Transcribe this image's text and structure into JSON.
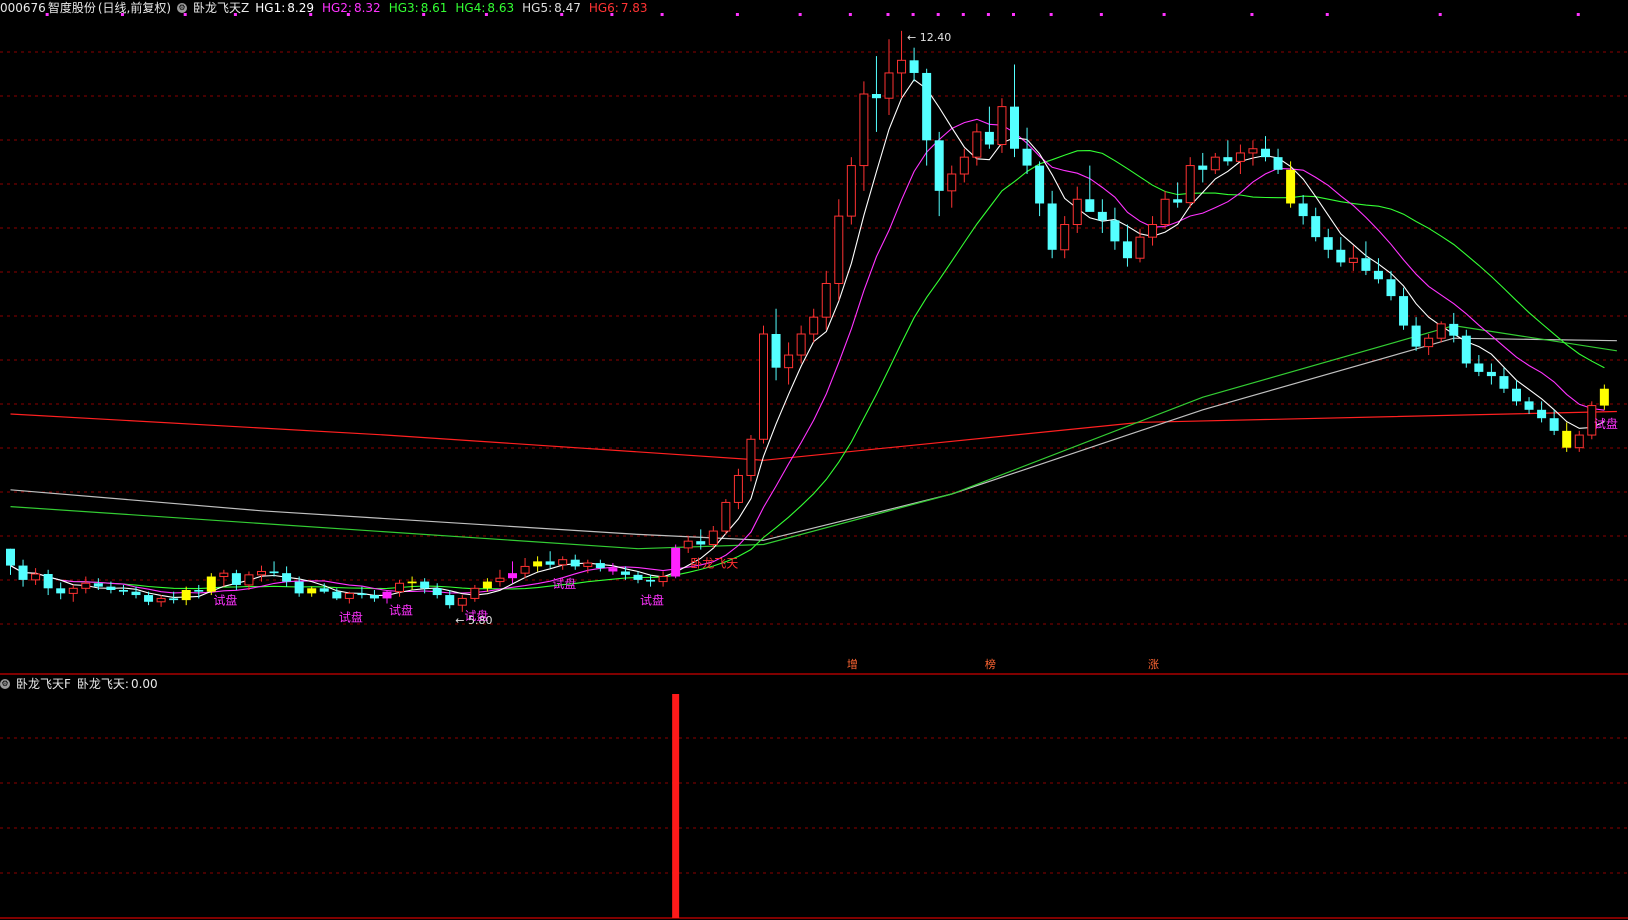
{
  "header": {
    "code": "000676",
    "stock_name": "智度股份",
    "period_label": "(日线,前复权)",
    "main_indicator": "卧龙飞天Z",
    "values": [
      {
        "label": "HG1:",
        "value": "8.29",
        "color": "#ffffff"
      },
      {
        "label": "HG2:",
        "value": "8.32",
        "color": "#ff33ff"
      },
      {
        "label": "HG3:",
        "value": "8.61",
        "color": "#33ff33"
      },
      {
        "label": "HG4:",
        "value": "8.63",
        "color": "#33ff33"
      },
      {
        "label": "HG5:",
        "value": "8.47",
        "color": "#dddddd"
      },
      {
        "label": "HG6:",
        "value": "7.83",
        "color": "#ff3333"
      }
    ]
  },
  "sub_header": {
    "indicator": "卧龙飞天F",
    "series_label": "卧龙飞天:",
    "series_value": "0.00"
  },
  "colors": {
    "up": "#ff3232",
    "down": "#54ffff",
    "ma1": "#ffffff",
    "ma2": "#ff33ff",
    "ma3": "#33ff33",
    "ma4": "#33cc33",
    "ma5": "#c0c0c0",
    "ma6": "#ff2020",
    "grid": "#8b0000",
    "signal_yellow": "#ffff00",
    "signal_magenta": "#ff22ff"
  },
  "chart_data": {
    "type": "candlestick",
    "ylim": [
      5.0,
      12.6
    ],
    "max_label": "12.40",
    "min_label": "5.80",
    "ohlc": [
      [
        6.25,
        6.25,
        5.94,
        6.05
      ],
      [
        6.05,
        6.12,
        5.8,
        5.88
      ],
      [
        5.88,
        6.02,
        5.82,
        5.95
      ],
      [
        5.95,
        6.0,
        5.7,
        5.78
      ],
      [
        5.78,
        5.85,
        5.65,
        5.72
      ],
      [
        5.72,
        5.82,
        5.62,
        5.78
      ],
      [
        5.78,
        5.92,
        5.72,
        5.84
      ],
      [
        5.84,
        5.9,
        5.76,
        5.8
      ],
      [
        5.8,
        5.86,
        5.72,
        5.76
      ],
      [
        5.76,
        5.82,
        5.7,
        5.74
      ],
      [
        5.74,
        5.8,
        5.66,
        5.7
      ],
      [
        5.7,
        5.74,
        5.58,
        5.62
      ],
      [
        5.62,
        5.7,
        5.56,
        5.66
      ],
      [
        5.66,
        5.74,
        5.6,
        5.64
      ],
      [
        5.64,
        5.8,
        5.58,
        5.76
      ],
      [
        5.76,
        5.82,
        5.66,
        5.74
      ],
      [
        5.74,
        5.96,
        5.7,
        5.92
      ],
      [
        5.92,
        6.0,
        5.8,
        5.96
      ],
      [
        5.96,
        6.0,
        5.76,
        5.82
      ],
      [
        5.82,
        5.98,
        5.76,
        5.94
      ],
      [
        5.94,
        6.05,
        5.86,
        5.98
      ],
      [
        5.98,
        6.1,
        5.92,
        5.96
      ],
      [
        5.96,
        6.04,
        5.8,
        5.86
      ],
      [
        5.86,
        5.92,
        5.68,
        5.72
      ],
      [
        5.72,
        5.8,
        5.68,
        5.78
      ],
      [
        5.78,
        5.84,
        5.72,
        5.74
      ],
      [
        5.74,
        5.78,
        5.64,
        5.66
      ],
      [
        5.66,
        5.74,
        5.6,
        5.72
      ],
      [
        5.72,
        5.8,
        5.66,
        5.7
      ],
      [
        5.7,
        5.76,
        5.62,
        5.66
      ],
      [
        5.66,
        5.76,
        5.6,
        5.74
      ],
      [
        5.74,
        5.88,
        5.68,
        5.84
      ],
      [
        5.84,
        5.92,
        5.76,
        5.86
      ],
      [
        5.86,
        5.9,
        5.72,
        5.78
      ],
      [
        5.78,
        5.84,
        5.66,
        5.7
      ],
      [
        5.7,
        5.76,
        5.54,
        5.58
      ],
      [
        5.58,
        5.7,
        5.5,
        5.66
      ],
      [
        5.66,
        5.82,
        5.62,
        5.78
      ],
      [
        5.78,
        5.9,
        5.74,
        5.86
      ],
      [
        5.86,
        6.0,
        5.8,
        5.9
      ],
      [
        5.9,
        6.1,
        5.84,
        5.96
      ],
      [
        5.96,
        6.14,
        5.9,
        6.04
      ],
      [
        6.04,
        6.16,
        5.98,
        6.1
      ],
      [
        6.1,
        6.22,
        6.02,
        6.06
      ],
      [
        6.06,
        6.16,
        6.0,
        6.12
      ],
      [
        6.12,
        6.18,
        6.0,
        6.04
      ],
      [
        6.04,
        6.12,
        5.96,
        6.08
      ],
      [
        6.08,
        6.12,
        5.98,
        6.02
      ],
      [
        6.02,
        6.08,
        5.94,
        5.98
      ],
      [
        5.98,
        6.04,
        5.88,
        5.94
      ],
      [
        5.94,
        5.98,
        5.84,
        5.88
      ],
      [
        5.88,
        5.94,
        5.8,
        5.86
      ],
      [
        5.86,
        5.98,
        5.8,
        5.92
      ],
      [
        5.92,
        6.3,
        5.9,
        6.26
      ],
      [
        6.26,
        6.4,
        6.2,
        6.34
      ],
      [
        6.34,
        6.48,
        6.24,
        6.3
      ],
      [
        6.3,
        6.52,
        6.26,
        6.46
      ],
      [
        6.46,
        6.84,
        6.42,
        6.8
      ],
      [
        6.8,
        7.2,
        6.72,
        7.12
      ],
      [
        7.12,
        7.6,
        7.05,
        7.55
      ],
      [
        7.55,
        8.9,
        7.5,
        8.8
      ],
      [
        8.8,
        9.1,
        8.25,
        8.4
      ],
      [
        8.4,
        8.7,
        8.2,
        8.55
      ],
      [
        8.55,
        8.9,
        8.45,
        8.8
      ],
      [
        8.8,
        9.1,
        8.7,
        9.0
      ],
      [
        9.0,
        9.55,
        8.85,
        9.4
      ],
      [
        9.4,
        10.4,
        9.2,
        10.2
      ],
      [
        10.2,
        10.9,
        10.1,
        10.8
      ],
      [
        10.8,
        11.8,
        10.5,
        11.65
      ],
      [
        11.65,
        12.1,
        11.2,
        11.6
      ],
      [
        11.6,
        12.3,
        11.4,
        11.9
      ],
      [
        11.9,
        12.4,
        11.6,
        12.05
      ],
      [
        12.05,
        12.2,
        11.8,
        11.9
      ],
      [
        11.9,
        11.95,
        10.8,
        11.1
      ],
      [
        11.1,
        11.2,
        10.2,
        10.5
      ],
      [
        10.5,
        10.8,
        10.3,
        10.7
      ],
      [
        10.7,
        11.0,
        10.6,
        10.9
      ],
      [
        10.9,
        11.3,
        10.8,
        11.2
      ],
      [
        11.2,
        11.5,
        11.0,
        11.05
      ],
      [
        11.05,
        11.6,
        10.95,
        11.5
      ],
      [
        11.5,
        12.0,
        10.9,
        11.0
      ],
      [
        11.0,
        11.25,
        10.7,
        10.8
      ],
      [
        10.8,
        10.85,
        10.2,
        10.35
      ],
      [
        10.35,
        10.5,
        9.7,
        9.8
      ],
      [
        9.8,
        10.2,
        9.7,
        10.1
      ],
      [
        10.1,
        10.55,
        10.0,
        10.4
      ],
      [
        10.4,
        10.8,
        10.3,
        10.25
      ],
      [
        10.25,
        10.4,
        10.0,
        10.15
      ],
      [
        10.15,
        10.3,
        9.8,
        9.9
      ],
      [
        9.9,
        10.1,
        9.6,
        9.7
      ],
      [
        9.7,
        10.05,
        9.65,
        9.95
      ],
      [
        9.95,
        10.2,
        9.85,
        10.1
      ],
      [
        10.1,
        10.5,
        10.05,
        10.4
      ],
      [
        10.4,
        10.6,
        10.3,
        10.36
      ],
      [
        10.36,
        10.9,
        10.3,
        10.8
      ],
      [
        10.8,
        10.95,
        10.6,
        10.75
      ],
      [
        10.75,
        10.95,
        10.7,
        10.9
      ],
      [
        10.9,
        11.1,
        10.8,
        10.85
      ],
      [
        10.85,
        11.05,
        10.7,
        10.95
      ],
      [
        10.95,
        11.1,
        10.8,
        11.0
      ],
      [
        11.0,
        11.15,
        10.85,
        10.9
      ],
      [
        10.9,
        11.0,
        10.7,
        10.75
      ],
      [
        10.75,
        10.85,
        10.3,
        10.35
      ],
      [
        10.35,
        10.45,
        10.1,
        10.2
      ],
      [
        10.2,
        10.3,
        9.9,
        9.95
      ],
      [
        9.95,
        10.05,
        9.7,
        9.8
      ],
      [
        9.8,
        9.95,
        9.6,
        9.65
      ],
      [
        9.65,
        9.85,
        9.55,
        9.7
      ],
      [
        9.7,
        9.9,
        9.5,
        9.55
      ],
      [
        9.55,
        9.7,
        9.4,
        9.45
      ],
      [
        9.45,
        9.55,
        9.2,
        9.25
      ],
      [
        9.25,
        9.35,
        8.85,
        8.9
      ],
      [
        8.9,
        9.0,
        8.6,
        8.65
      ],
      [
        8.65,
        8.8,
        8.55,
        8.75
      ],
      [
        8.75,
        8.95,
        8.7,
        8.92
      ],
      [
        8.92,
        9.05,
        8.7,
        8.78
      ],
      [
        8.78,
        8.85,
        8.4,
        8.45
      ],
      [
        8.45,
        8.55,
        8.3,
        8.35
      ],
      [
        8.35,
        8.45,
        8.2,
        8.3
      ],
      [
        8.3,
        8.4,
        8.1,
        8.15
      ],
      [
        8.15,
        8.25,
        7.95,
        8.0
      ],
      [
        8.0,
        8.05,
        7.85,
        7.9
      ],
      [
        7.9,
        8.0,
        7.75,
        7.8
      ],
      [
        7.8,
        7.9,
        7.6,
        7.65
      ],
      [
        7.65,
        7.75,
        7.4,
        7.45
      ],
      [
        7.45,
        7.65,
        7.4,
        7.6
      ],
      [
        7.6,
        8.0,
        7.55,
        7.95
      ],
      [
        7.95,
        8.2,
        7.9,
        8.15
      ]
    ],
    "signal_candles": [
      {
        "index": 14,
        "color": "yellow"
      },
      {
        "index": 16,
        "color": "yellow"
      },
      {
        "index": 24,
        "color": "yellow"
      },
      {
        "index": 30,
        "color": "magenta"
      },
      {
        "index": 32,
        "color": "yellow"
      },
      {
        "index": 38,
        "color": "yellow"
      },
      {
        "index": 40,
        "color": "magenta"
      },
      {
        "index": 42,
        "color": "yellow"
      },
      {
        "index": 48,
        "color": "magenta"
      },
      {
        "index": 53,
        "color": "magenta"
      },
      {
        "index": 102,
        "color": "yellow"
      },
      {
        "index": 124,
        "color": "yellow"
      },
      {
        "index": 127,
        "color": "yellow"
      }
    ],
    "labels": [
      {
        "index": 17,
        "text": "试盘",
        "color": "magenta"
      },
      {
        "index": 27,
        "text": "试盘",
        "color": "magenta"
      },
      {
        "index": 31,
        "text": "试盘",
        "color": "magenta"
      },
      {
        "index": 37,
        "text": "试盘",
        "color": "magenta"
      },
      {
        "index": 44,
        "text": "试盘",
        "color": "magenta"
      },
      {
        "index": 51,
        "text": "试盘",
        "color": "magenta"
      },
      {
        "index": 55,
        "text": "卧龙飞天",
        "color": "red"
      },
      {
        "index": 127,
        "text": "试盘",
        "color": "magenta"
      }
    ],
    "markers": [
      {
        "index": 67,
        "text": "增"
      },
      {
        "index": 78,
        "text": "榜"
      },
      {
        "index": 91,
        "text": "涨"
      }
    ],
    "dots": [
      3,
      9,
      14,
      18,
      24,
      27,
      33,
      38,
      44,
      48,
      52,
      58,
      63,
      67,
      70,
      72,
      74,
      76,
      78,
      80,
      83,
      87,
      92,
      99,
      105,
      114,
      125
    ],
    "long_lines": {
      "ma5": [
        [
          0,
          6.95
        ],
        [
          20,
          6.7
        ],
        [
          50,
          6.42
        ],
        [
          60,
          6.35
        ],
        [
          75,
          6.9
        ],
        [
          95,
          7.9
        ],
        [
          115,
          8.75
        ],
        [
          128,
          8.72
        ]
      ],
      "ma4": [
        [
          0,
          6.75
        ],
        [
          20,
          6.55
        ],
        [
          50,
          6.25
        ],
        [
          60,
          6.3
        ],
        [
          75,
          6.9
        ],
        [
          95,
          8.05
        ],
        [
          115,
          8.9
        ],
        [
          128,
          8.6
        ]
      ],
      "ma6": [
        [
          0,
          7.85
        ],
        [
          30,
          7.6
        ],
        [
          60,
          7.3
        ],
        [
          90,
          7.75
        ],
        [
          128,
          7.88
        ]
      ]
    },
    "sub": {
      "ylim": [
        0,
        1
      ],
      "values": [
        {
          "index": 53,
          "value": 1
        }
      ]
    }
  }
}
